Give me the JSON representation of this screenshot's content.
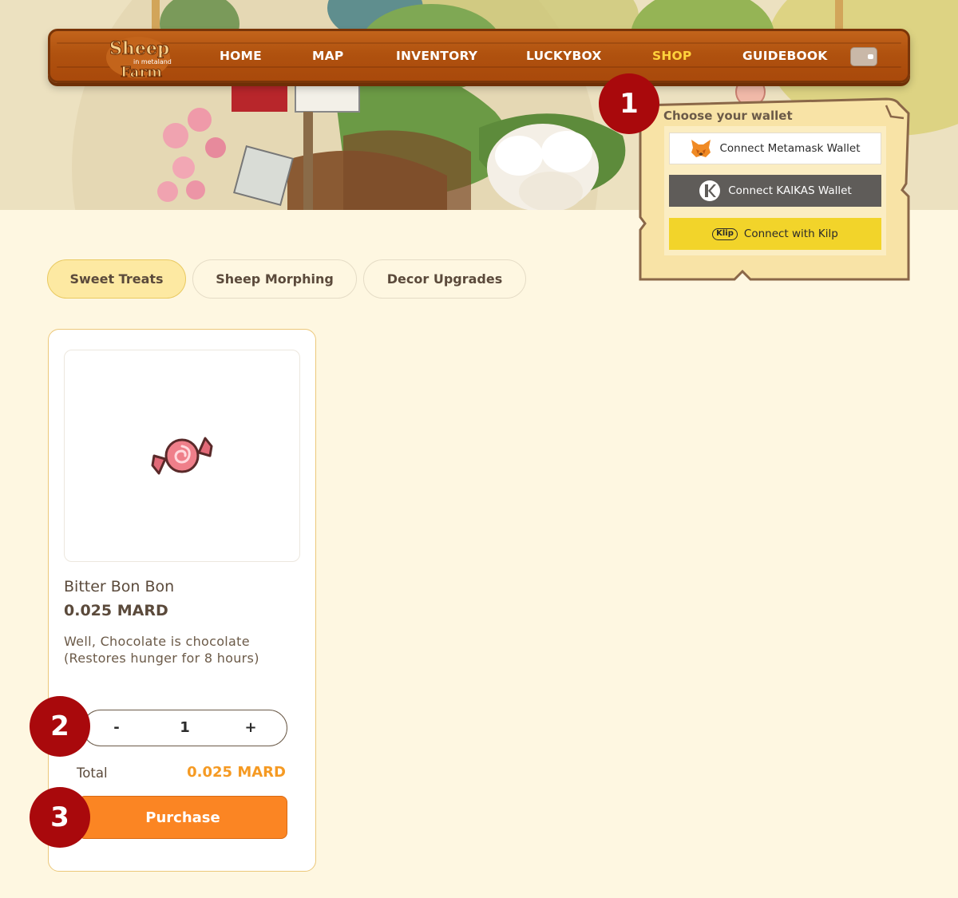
{
  "nav": {
    "logo_text": "Sheep Farm in metaland",
    "items": [
      {
        "label": "HOME",
        "active": false
      },
      {
        "label": "MAP",
        "active": false
      },
      {
        "label": "INVENTORY",
        "active": false
      },
      {
        "label": "LUCKYBOX",
        "active": false
      },
      {
        "label": "SHOP",
        "active": true
      },
      {
        "label": "GUIDEBOOK",
        "active": false
      }
    ],
    "wallet_icon": "wallet-icon",
    "colors": {
      "bar": "#b0520f",
      "text": "#ffffff",
      "active": "#ffd23c"
    }
  },
  "wallet_popup": {
    "title": "Choose your wallet",
    "options": [
      {
        "label": "Connect Metamask Wallet",
        "icon": "metamask-fox-icon",
        "color": "#ffffff"
      },
      {
        "label": "Connect KAIKAS Wallet",
        "icon": "kaikas-icon",
        "color": "#5f5c59"
      },
      {
        "label": "Connect with Kilp",
        "icon": "klip-icon",
        "icon_text": "Klip",
        "color": "#f2d42a"
      }
    ]
  },
  "markers": [
    "1",
    "2",
    "3"
  ],
  "tabs": [
    {
      "label": "Sweet Treats",
      "active": true
    },
    {
      "label": "Sheep Morphing",
      "active": false
    },
    {
      "label": "Decor Upgrades",
      "active": false
    }
  ],
  "product": {
    "icon": "candy-icon",
    "name": "Bitter Bon Bon",
    "price": "0.025 MARD",
    "description_line1": "Well, Chocolate is chocolate",
    "description_line2": "(Restores hunger for 8 hours)",
    "quantity": "1",
    "minus_label": "-",
    "plus_label": "+",
    "total_label": "Total",
    "total_value": "0.025 MARD",
    "purchase_label": "Purchase"
  },
  "colors": {
    "background": "#fef7e1",
    "accent_orange": "#fb8523",
    "marker_red": "#a9090c"
  }
}
